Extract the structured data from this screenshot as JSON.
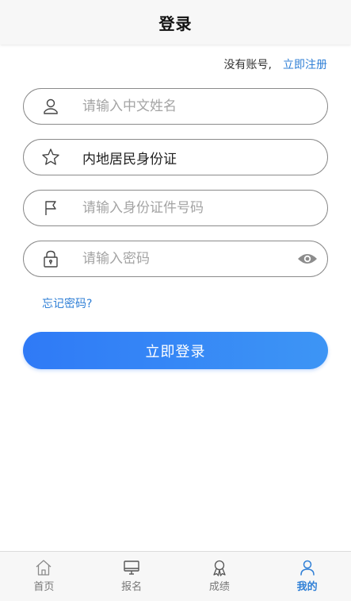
{
  "header": {
    "title": "登录"
  },
  "register": {
    "prompt": "没有账号,",
    "link": "立即注册"
  },
  "form": {
    "name_placeholder": "请输入中文姓名",
    "id_type_value": "内地居民身份证",
    "id_number_placeholder": "请输入身份证件号码",
    "password_placeholder": "请输入密码",
    "forgot_label": "忘记密码?",
    "submit_label": "立即登录"
  },
  "icons": {
    "name": "user-icon",
    "id_type": "star-icon",
    "id_number": "flag-icon",
    "password": "lock-icon",
    "toggle": "eye-icon"
  },
  "tabs": [
    {
      "label": "首页",
      "icon": "home-icon",
      "active": false
    },
    {
      "label": "报名",
      "icon": "monitor-icon",
      "active": false
    },
    {
      "label": "成绩",
      "icon": "award-icon",
      "active": false
    },
    {
      "label": "我的",
      "icon": "person-icon",
      "active": true
    }
  ],
  "colors": {
    "accent": "#2f7fd6",
    "button_start": "#2f7af6",
    "button_end": "#3d95f5"
  }
}
